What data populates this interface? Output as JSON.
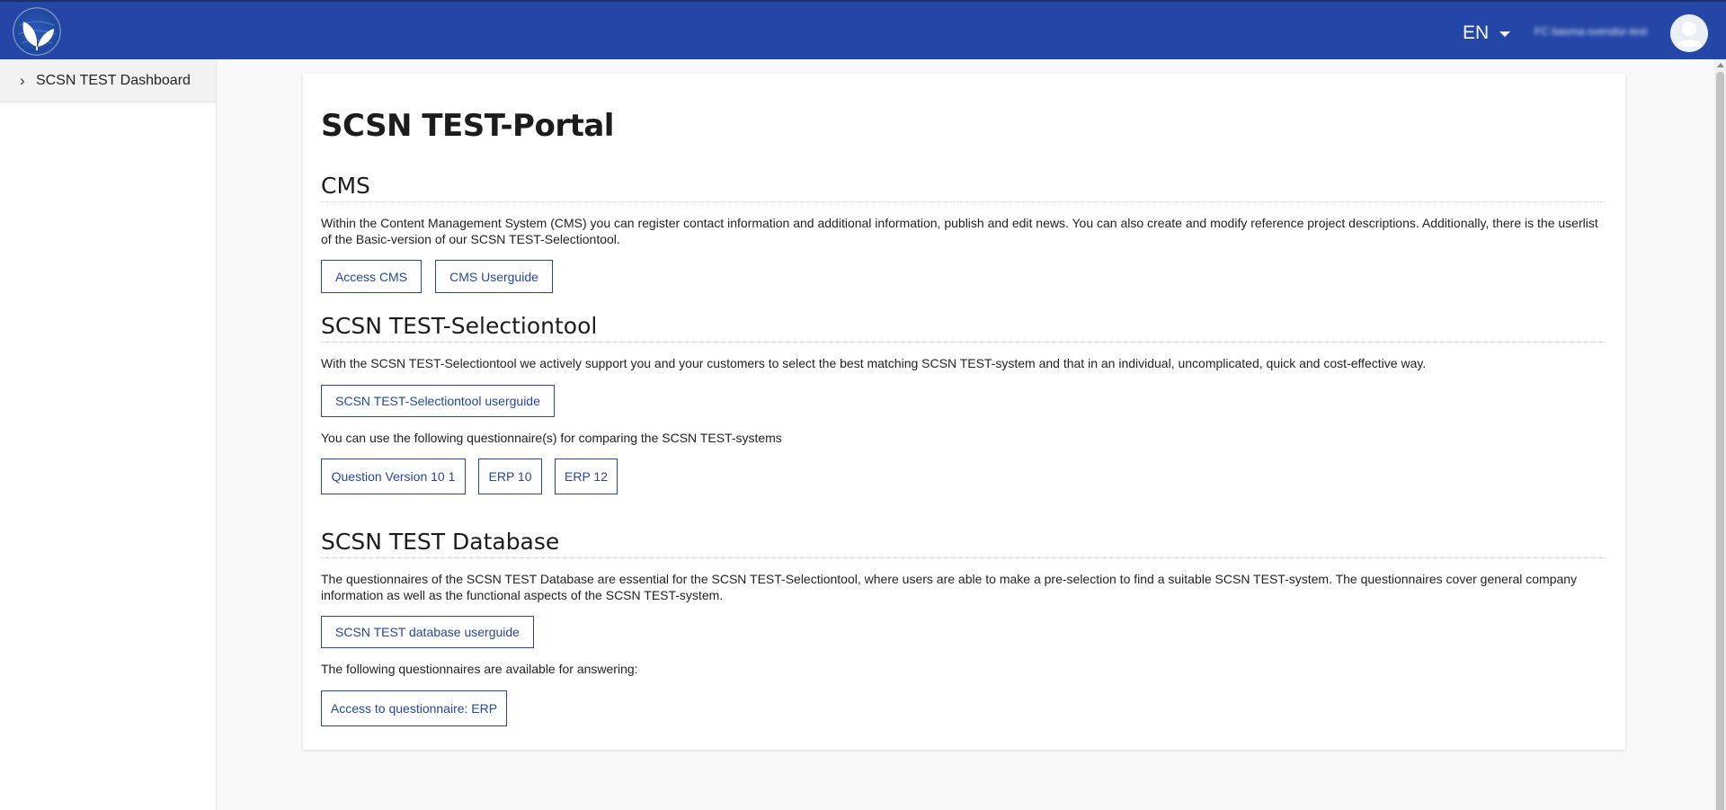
{
  "header": {
    "language": "EN",
    "username": "FC basma-svendor-test",
    "brand_color": "#2446a6"
  },
  "icons": {
    "logo": "leaf-globe-logo",
    "language_caret": "caret-down-icon",
    "avatar": "user-avatar-icon",
    "sidebar_chevron": "chevron-right-icon"
  },
  "sidebar": {
    "items": [
      {
        "label": "SCSN TEST Dashboard"
      }
    ]
  },
  "main": {
    "title": "SCSN TEST-Portal",
    "cms": {
      "heading": "CMS",
      "description": "Within the Content Management System (CMS) you can register contact information and additional information, publish and edit news. You can also create and modify reference project descriptions. Additionally, there is the userlist of the Basic-version of our SCSN TEST-Selectiontool.",
      "buttons": [
        "Access CMS",
        "CMS Userguide"
      ]
    },
    "selectiontool": {
      "heading": "SCSN TEST-Selectiontool",
      "description": "With the SCSN TEST-Selectiontool we actively support you and your customers to select the best matching SCSN TEST-system and that in an individual, uncomplicated, quick and cost-effective way.",
      "userguide_button": "SCSN TEST-Selectiontool userguide",
      "questionnaire_text": "You can use the following questionnaire(s) for comparing the SCSN TEST-systems",
      "questionnaire_buttons": [
        "Question Version 10 1",
        "ERP 10",
        "ERP 12"
      ]
    },
    "database": {
      "heading": "SCSN TEST Database",
      "description": "The questionnaires of the SCSN TEST Database are essential for the SCSN TEST-Selectiontool, where users are able to make a pre-selection to find a suitable SCSN TEST-system. The questionnaires cover general company information as well as the functional aspects of the SCSN TEST-system.",
      "userguide_button": "SCSN TEST database userguide",
      "available_text": "The following questionnaires are available for answering:",
      "questionnaire_buttons": [
        "Access to questionnaire: ERP"
      ]
    }
  }
}
